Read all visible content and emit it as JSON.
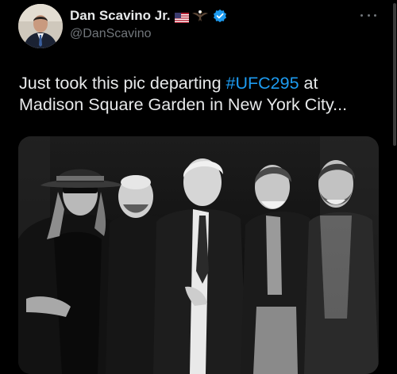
{
  "author": {
    "display_name": "Dan Scavino Jr.",
    "handle": "@DanScavino",
    "name_emojis": [
      "us-flag-icon",
      "eagle-icon"
    ],
    "verified": true,
    "verified_color": "#1d9bf0"
  },
  "tweet": {
    "text_before": "Just took this pic departing ",
    "hashtag": "#UFC295",
    "text_after": " at Madison Square Garden in New York City...",
    "hashtag_color": "#1d9bf0"
  },
  "media": {
    "type": "photo",
    "people_count": 5
  },
  "colors": {
    "background": "#000000",
    "text": "#e7e9ea",
    "secondary_text": "#71767b",
    "accent": "#1d9bf0"
  }
}
